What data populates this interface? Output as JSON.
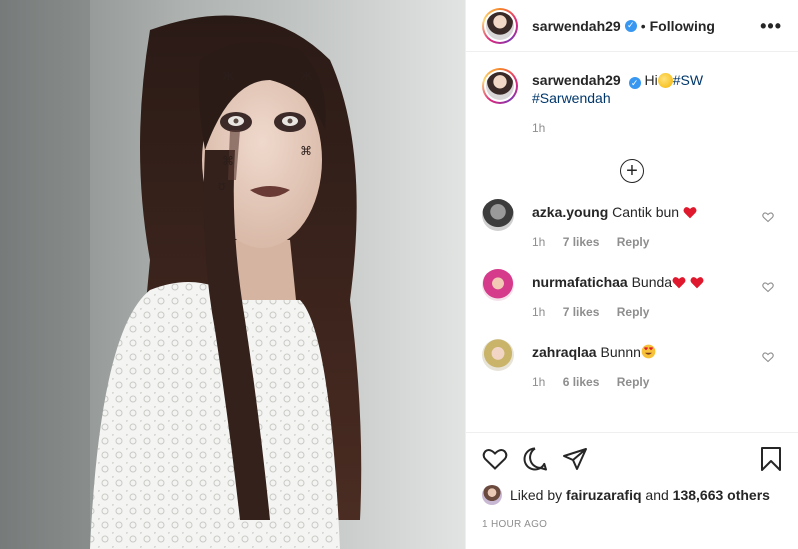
{
  "post": {
    "username": "sarwendah29",
    "verified_mark": "✓",
    "separator": "•",
    "follow_status": "Following",
    "more_icon": "•••"
  },
  "caption": {
    "username": "sarwendah29",
    "text_before": "Hi",
    "hashtag1": "#SW",
    "hashtag2": "#Sarwendah",
    "time": "1h"
  },
  "load_more_icon": "+",
  "comments": [
    {
      "username": "azka.young",
      "text": "Cantik bun",
      "time": "1h",
      "likes": "7 likes",
      "reply": "Reply",
      "emoji": "red-heart"
    },
    {
      "username": "nurmafatichaa",
      "text": "Bunda",
      "time": "1h",
      "likes": "7 likes",
      "reply": "Reply",
      "emoji": "two-red-hearts"
    },
    {
      "username": "zahraqlaa",
      "text": "Bunnn",
      "time": "1h",
      "likes": "6 likes",
      "reply": "Reply",
      "emoji": "heart-eyes"
    }
  ],
  "likes": {
    "prefix": "Liked by",
    "user": "fairuzarafiq",
    "connector": "and",
    "others": "138,663 others"
  },
  "timestamp": "1 HOUR AGO",
  "colors": {
    "hashtag": "#00376b",
    "verified": "#3897f0",
    "heart": "#ed4956",
    "muted": "#8e8e8e"
  }
}
